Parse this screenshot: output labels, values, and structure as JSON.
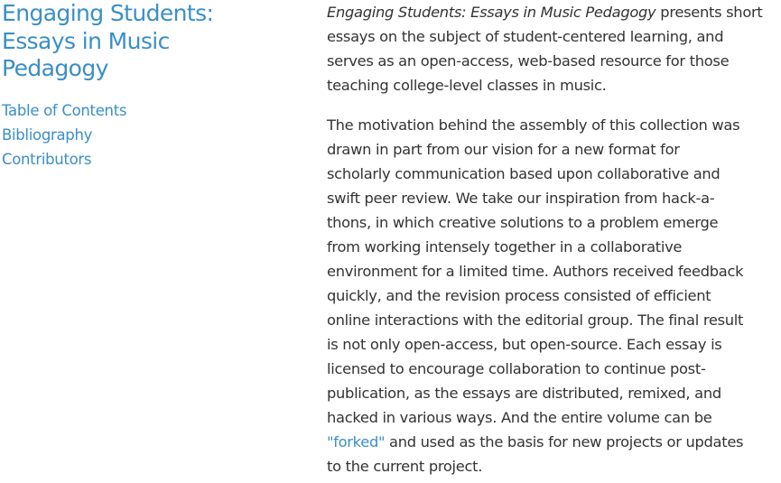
{
  "sidebar": {
    "title_lines": [
      "Engaging Students:",
      "Essays in Music",
      "Pedagogy"
    ],
    "nav": [
      {
        "label": "Table of Contents"
      },
      {
        "label": "Bibliography"
      },
      {
        "label": "Contributors"
      }
    ]
  },
  "content": {
    "intro": {
      "title_italic": "Engaging Students: Essays in Music Pedagogy",
      "line1_rest": " presents short",
      "lines": [
        "essays on the subject of student-centered learning, and",
        "serves as an open-access, web-based resource for those",
        "teaching college-level classes in music."
      ]
    },
    "motivation": {
      "lines": [
        "The motivation behind the assembly of this collection was",
        "drawn in part from our vision for a new format for",
        "scholarly communication based upon collaborative and",
        "swift peer review. We take our inspiration from hack-a-",
        "thons, in which creative solutions to a problem emerge",
        "from working intensely together in a collaborative",
        "environment for a limited time. Authors received feedback",
        "quickly, and the revision process consisted of efficient",
        "online interactions with the editorial group. The final result",
        "is not only open-access, but open-source. Each essay is",
        "licensed to encourage collaboration to continue post-",
        "publication, as the essays are distributed, remixed, and",
        "hacked in various ways. And the entire volume can be"
      ],
      "link_label": "\"forked\"",
      "after_link": " and used as the basis for new projects or updates",
      "last_line": "to the current project."
    }
  },
  "colors": {
    "link": "#3a8fc7",
    "text": "#333333",
    "background": "#ffffff"
  }
}
